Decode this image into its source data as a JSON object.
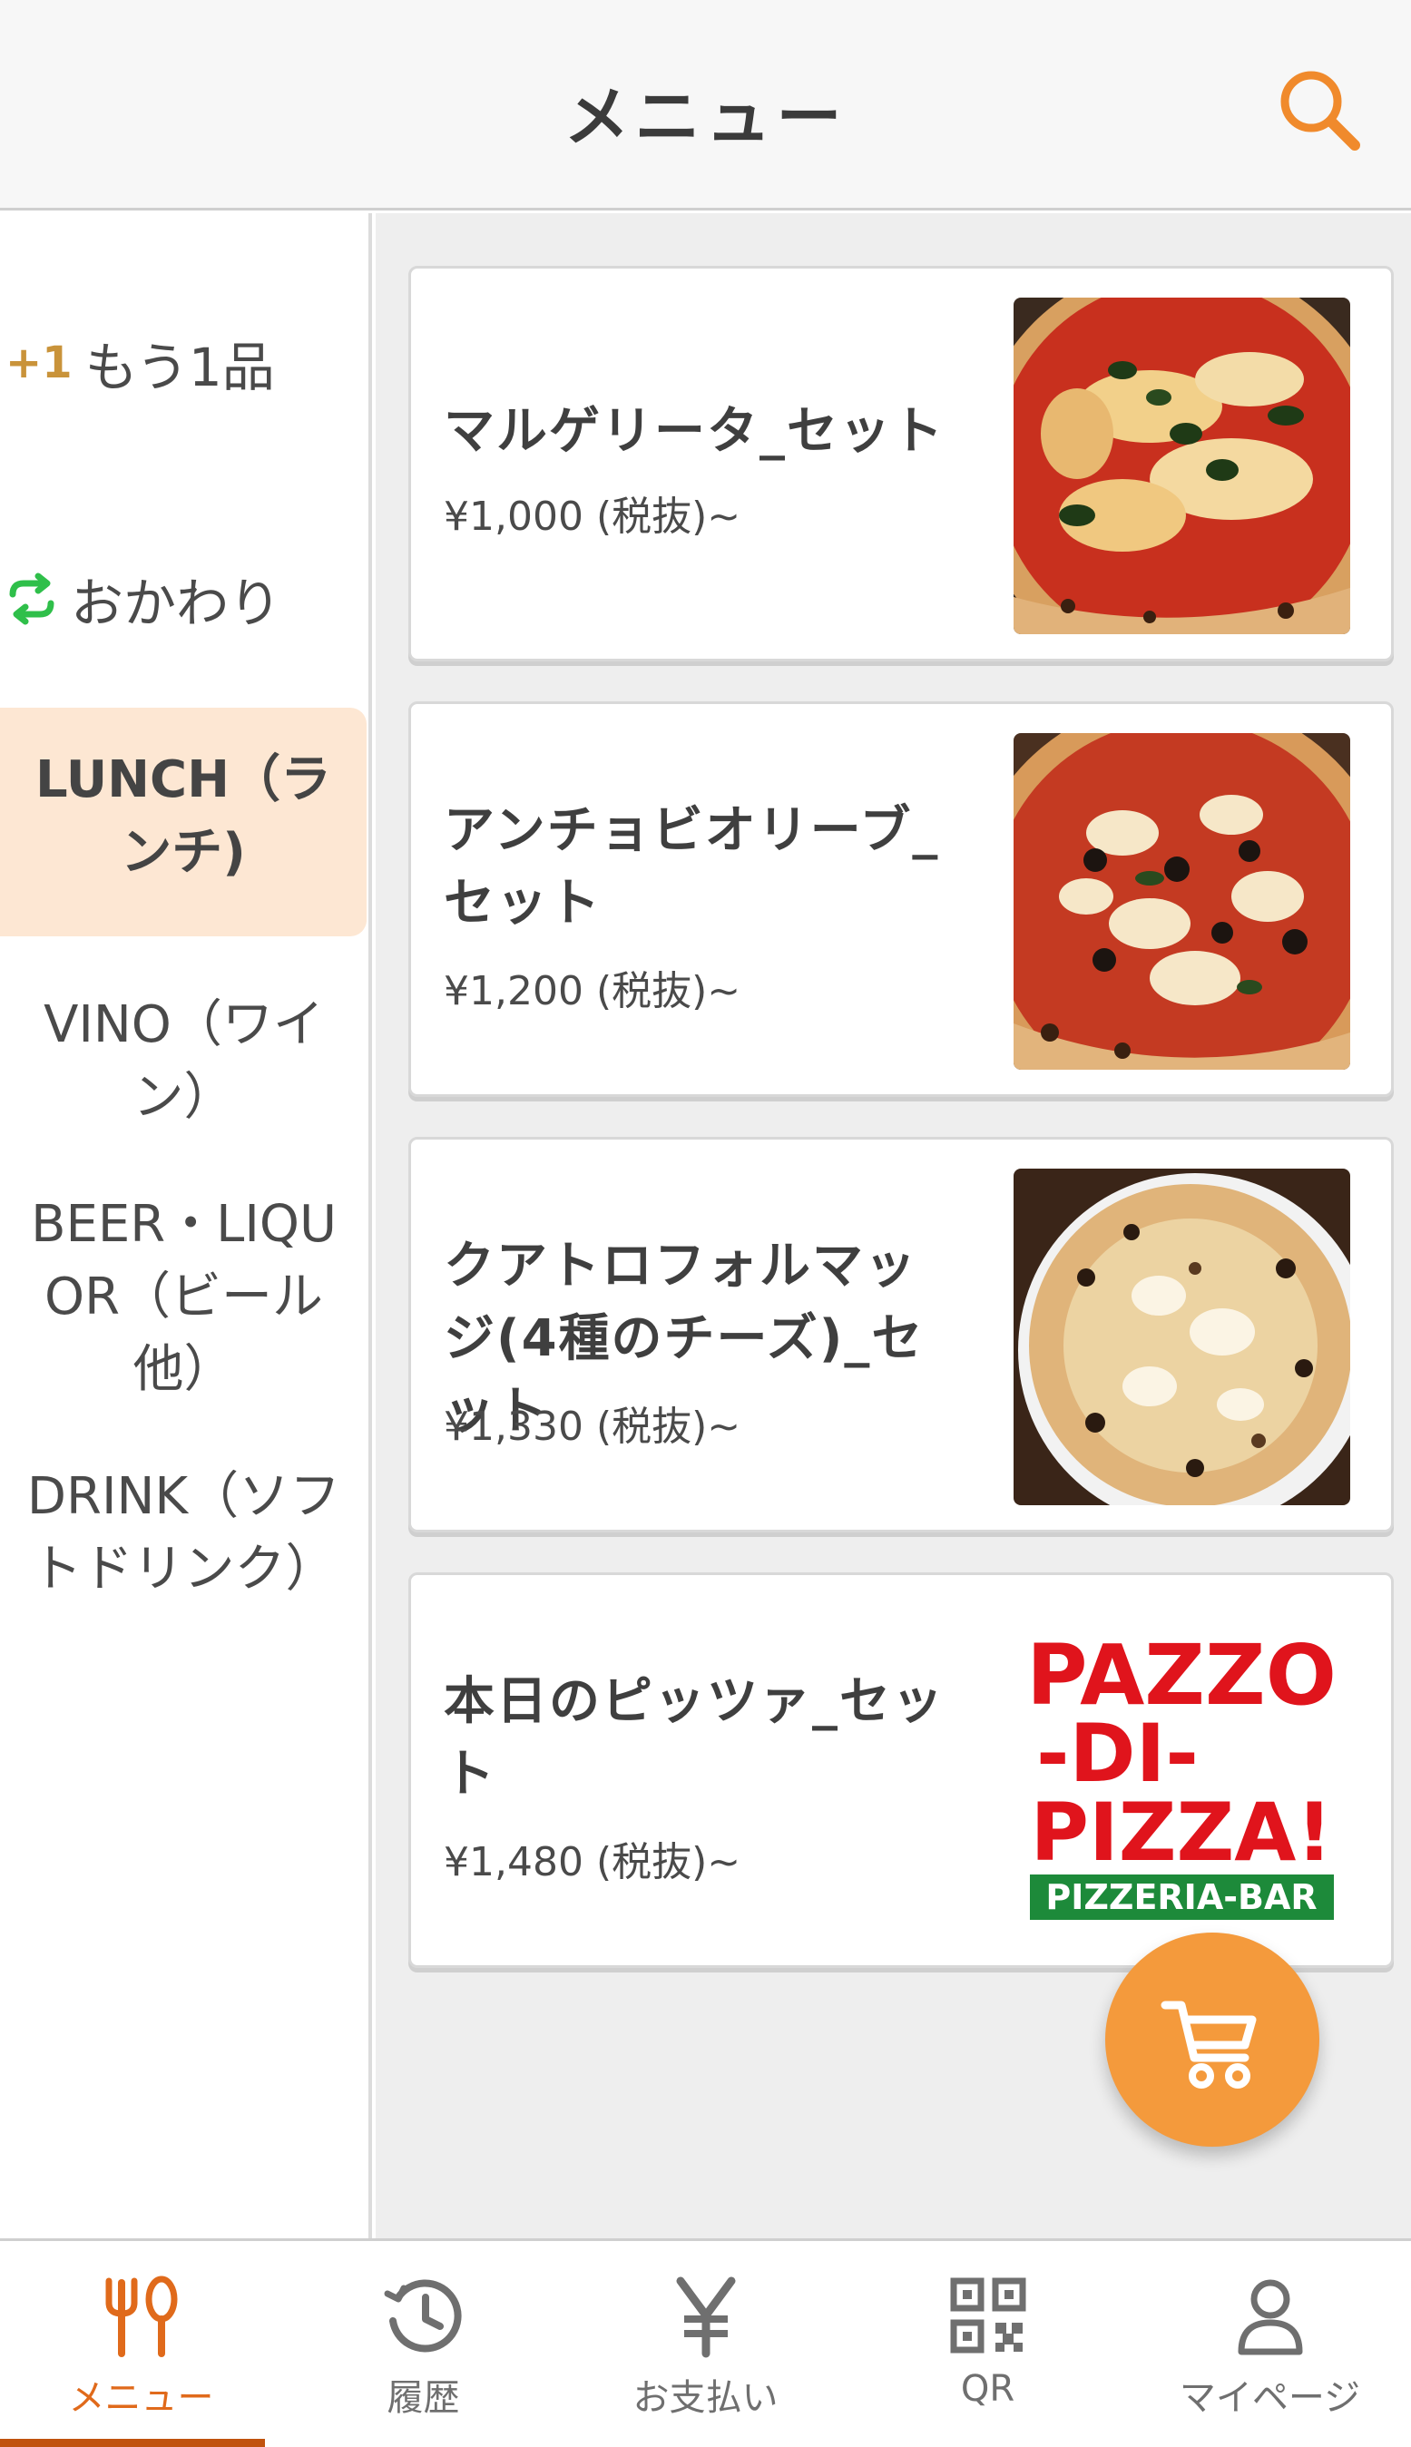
{
  "header": {
    "title": "メニュー"
  },
  "sidebar": {
    "quick": [
      {
        "label": "もう1品",
        "badge": "+1"
      },
      {
        "label": "おかわり"
      }
    ],
    "categories": [
      {
        "label": "LUNCH（ランチ)",
        "active": true
      },
      {
        "label": "VINO（ワイン）"
      },
      {
        "label": "BEER・LIQUOR（ビール他）"
      },
      {
        "label": "DRINK（ソフトドリンク）"
      }
    ]
  },
  "menu_items": [
    {
      "name": "マルゲリータ_セット",
      "price": "¥1,000 (税抜)~",
      "image": "margherita-pizza-photo"
    },
    {
      "name": "アンチョビオリーブ_セット",
      "price": "¥1,200 (税抜)~",
      "image": "anchovy-olive-pizza-photo"
    },
    {
      "name": "クアトロフォルマッジ(4種のチーズ)_セット",
      "price": "¥1,330 (税抜)~",
      "image": "quattro-formaggi-pizza-photo"
    },
    {
      "name": "本日のピッツァ_セット",
      "price": "¥1,480 (税抜)~",
      "image": "pazzo-di-pizza-logo"
    }
  ],
  "logo": {
    "line1": "PAZZO",
    "line2": "-DI-",
    "line3": "PIZZA!",
    "line4": "PIZZERIA-BAR"
  },
  "bottom_nav": [
    {
      "label": "メニュー",
      "icon": "fork-spoon-icon",
      "active": true
    },
    {
      "label": "履歴",
      "icon": "history-icon"
    },
    {
      "label": "お支払い",
      "icon": "yen-icon"
    },
    {
      "label": "QR",
      "icon": "qr-code-icon"
    },
    {
      "label": "マイページ",
      "icon": "user-icon"
    }
  ],
  "colors": {
    "accent": "#f49a3c",
    "nav_active": "#e06a1b",
    "active_category_bg": "#fde7d3",
    "plus_one": "#c9933a",
    "refill_green": "#2fbf4a"
  }
}
